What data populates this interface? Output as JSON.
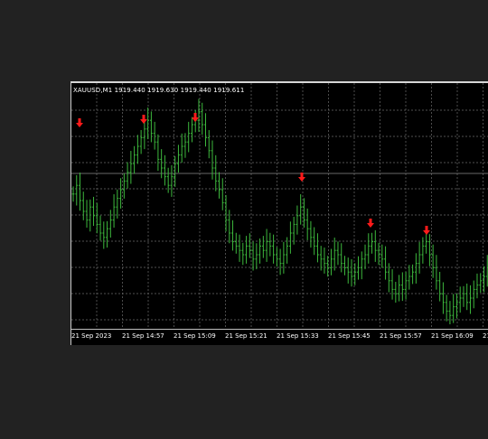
{
  "chart": {
    "symbol_info": "XAUUSD,M1  1919.440 1919.630 1919.440 1919.611",
    "time_labels": [
      "21 Sep 2023",
      "21 Sep 14:57",
      "21 Sep 15:09",
      "21 Sep 15:21",
      "21 Sep 15:33",
      "21 Sep 15:45",
      "21 Sep 15:57",
      "21 Sep 16:09",
      "21"
    ]
  },
  "colors": {
    "background": "#222222",
    "chart_bg": "#000000",
    "grid": "#6b6b6b",
    "bars": "#3db83d",
    "sell_arrows": "#ff1a1a",
    "ask_line": "#8a8a8a"
  },
  "chart_data": {
    "type": "ohlc",
    "series": [
      {
        "values": [
          0.58,
          0.62,
          0.55,
          0.5,
          0.46,
          0.52,
          0.48,
          0.44,
          0.4,
          0.38,
          0.42,
          0.46,
          0.52,
          0.56,
          0.6,
          0.64,
          0.68,
          0.72,
          0.76,
          0.8,
          0.84,
          0.88,
          0.92,
          0.86,
          0.82,
          0.74,
          0.7,
          0.66,
          0.62,
          0.66,
          0.72,
          0.76,
          0.8,
          0.82,
          0.86,
          0.9,
          0.92,
          0.96,
          0.9,
          0.84,
          0.78,
          0.7,
          0.64,
          0.6,
          0.54,
          0.46,
          0.4,
          0.36,
          0.34,
          0.32,
          0.3,
          0.34,
          0.32,
          0.28,
          0.3,
          0.34,
          0.32,
          0.36,
          0.34,
          0.3,
          0.28,
          0.26,
          0.3,
          0.34,
          0.4,
          0.44,
          0.48,
          0.52,
          0.46,
          0.42,
          0.38,
          0.34,
          0.3,
          0.28,
          0.26,
          0.24,
          0.28,
          0.32,
          0.3,
          0.26,
          0.24,
          0.22,
          0.2,
          0.22,
          0.24,
          0.28,
          0.3,
          0.34,
          0.36,
          0.32,
          0.3,
          0.28,
          0.22,
          0.18,
          0.14,
          0.12,
          0.16,
          0.14,
          0.18,
          0.2,
          0.22,
          0.26,
          0.3,
          0.34,
          0.36,
          0.3,
          0.24,
          0.18,
          0.12,
          0.08,
          0.04,
          0.02,
          0.06,
          0.08,
          0.1,
          0.12,
          0.08,
          0.1,
          0.14,
          0.16,
          0.18,
          0.2,
          0.24
        ]
      }
    ],
    "sell_signals_at_index": [
      3,
      33,
      47,
      106,
      132,
      150
    ]
  }
}
